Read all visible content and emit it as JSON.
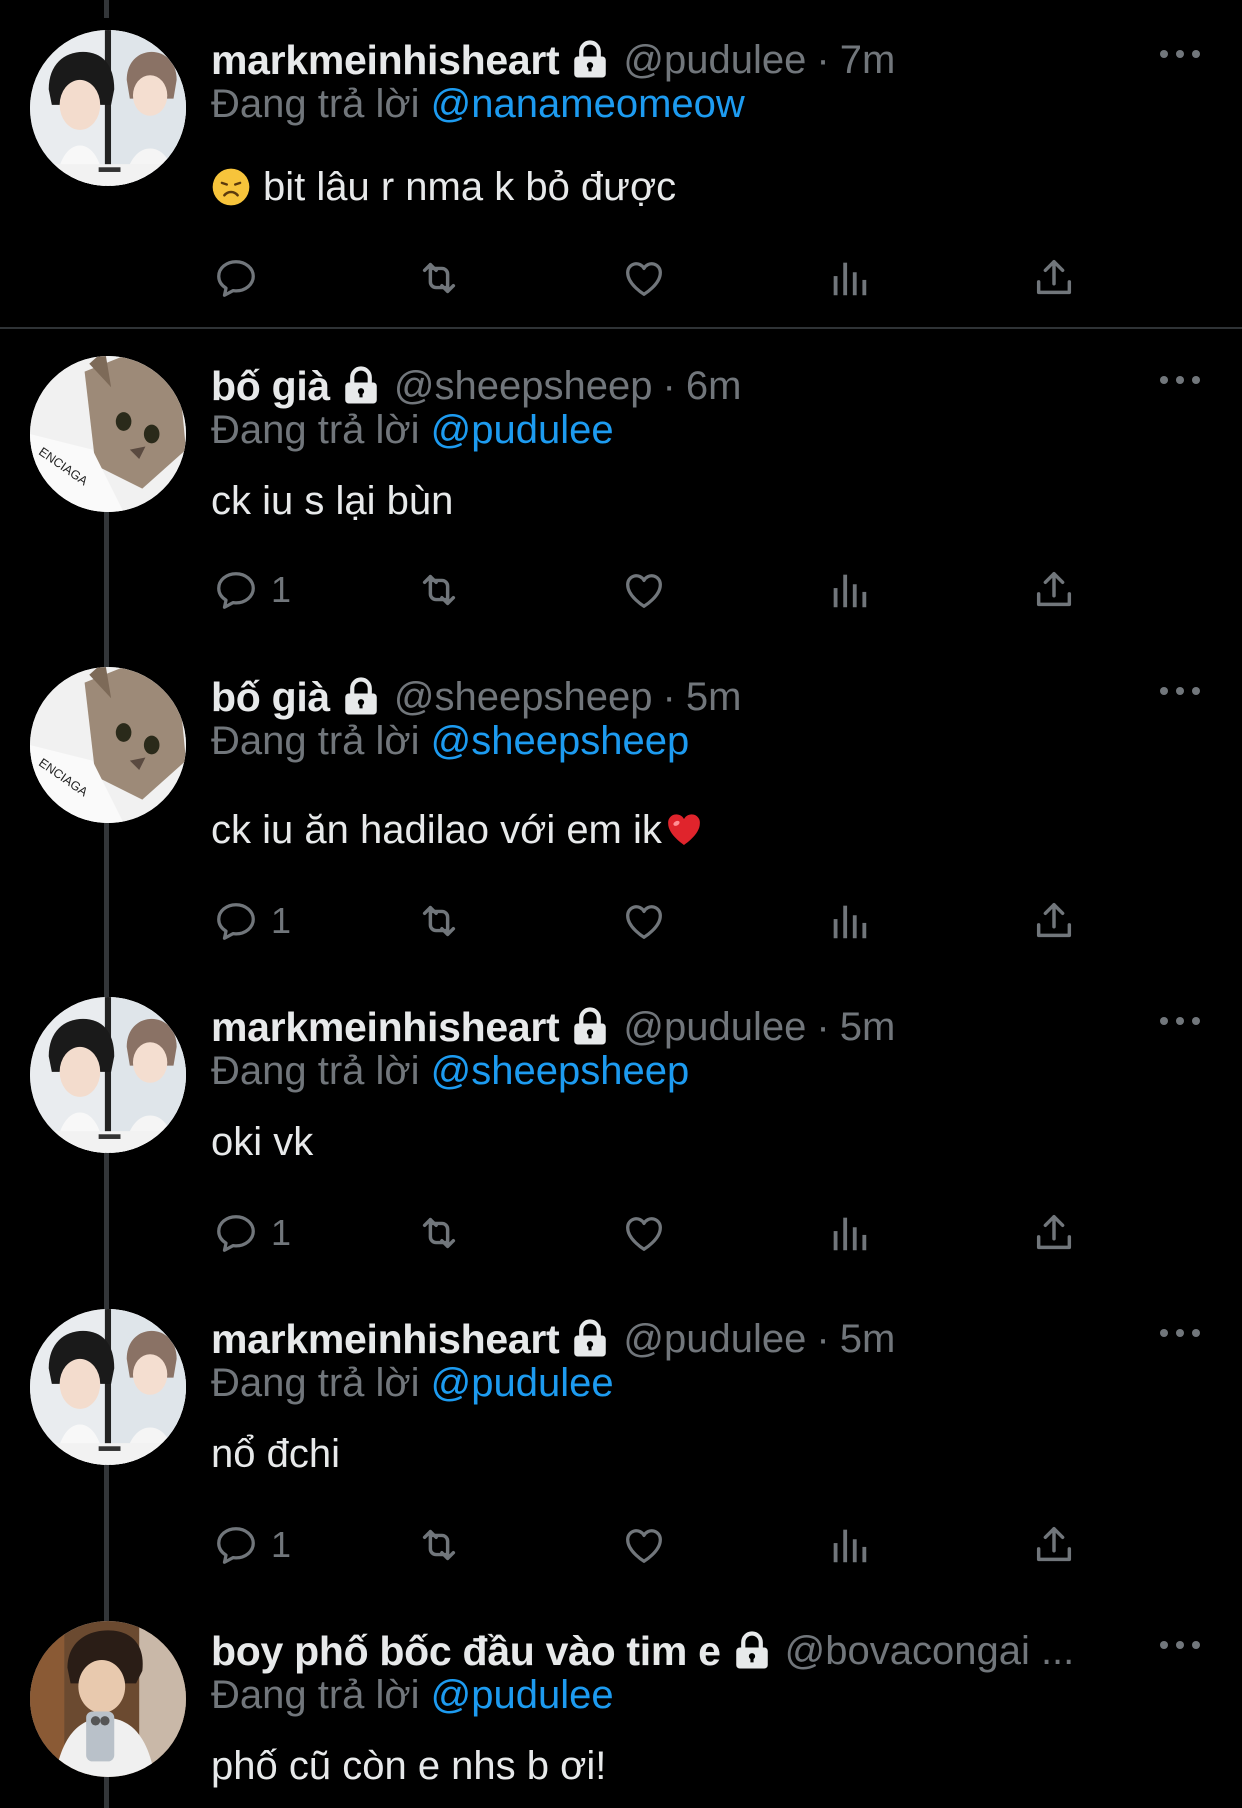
{
  "tweets": [
    {
      "name": "markmeinhisheart",
      "handle": "@pudulee",
      "time": "7m",
      "replying_label": "Đang trả lời",
      "replying_to": "@nanameomeow",
      "text": "bit lâu r nma k bỏ được",
      "reply_count": ""
    },
    {
      "name": "bố già",
      "handle": "@sheepsheep",
      "time": "6m",
      "replying_label": "Đang trả lời",
      "replying_to": "@pudulee",
      "text": "ck iu s lại bùn",
      "reply_count": "1"
    },
    {
      "name": "bố già",
      "handle": "@sheepsheep",
      "time": "5m",
      "replying_label": "Đang trả lời",
      "replying_to": "@sheepsheep",
      "text": "ck iu ăn hadilao với em ik",
      "reply_count": "1"
    },
    {
      "name": "markmeinhisheart",
      "handle": "@pudulee",
      "time": "5m",
      "replying_label": "Đang trả lời",
      "replying_to": "@sheepsheep",
      "text": "oki vk",
      "reply_count": "1"
    },
    {
      "name": "markmeinhisheart",
      "handle": "@pudulee",
      "time": "5m",
      "replying_label": "Đang trả lời",
      "replying_to": "@pudulee",
      "text": "nổ đchi",
      "reply_count": "1"
    },
    {
      "name": "boy phố bốc đầu vào tim e",
      "handle": "@bovacongai ...",
      "time": "",
      "replying_label": "Đang trả lời",
      "replying_to": "@pudulee",
      "text": "phố cũ còn e nhs b ơi!",
      "reply_count": ""
    }
  ],
  "colors": {
    "background": "#000000",
    "text": "#e7e9ea",
    "muted": "#71767b",
    "accent": "#1d9bf0"
  },
  "icons": [
    "lock-icon",
    "more-icon",
    "reply-icon",
    "retweet-icon",
    "like-icon",
    "views-icon",
    "share-icon",
    "disappointed-emoji",
    "red-heart-emoji"
  ]
}
